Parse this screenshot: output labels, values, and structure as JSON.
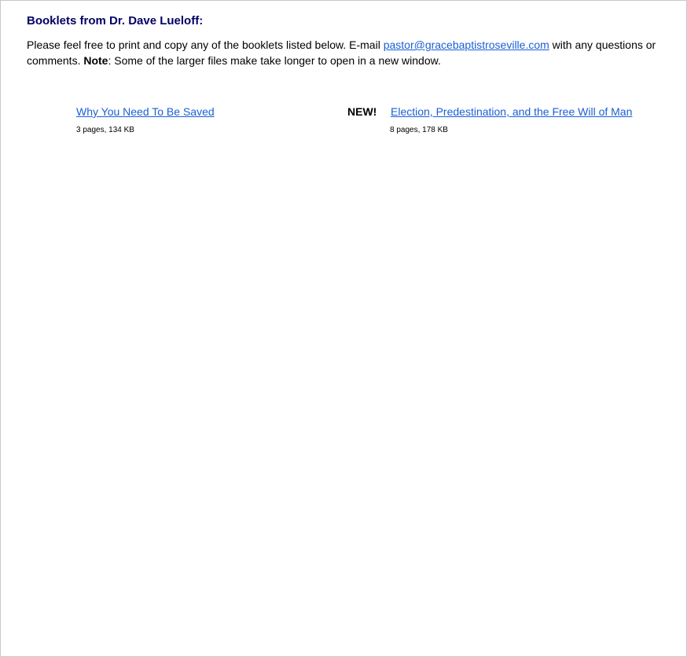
{
  "page": {
    "heading": "Booklets from Dr. Dave Lueloff:",
    "intro": {
      "text_before_email": "Please feel free to print and copy any of the booklets listed below. E-mail ",
      "email": "pastor@gracebaptistroseville.com",
      "text_after_email": " with any questions or comments.  ",
      "note_label": "Note",
      "note_text": ": Some of the larger files make take longer to open in a new window."
    }
  },
  "booklets": [
    {
      "title": "Why You Need To Be Saved",
      "meta": "3 pages, 134 KB",
      "badge": ""
    },
    {
      "title": "Election, Predestination, and the Free Will of Man",
      "meta": "8 pages,  178 KB",
      "badge": "NEW!"
    }
  ],
  "colors": {
    "heading": "#000066",
    "link": "#1a5fd6",
    "border": "#c8c8c8"
  }
}
